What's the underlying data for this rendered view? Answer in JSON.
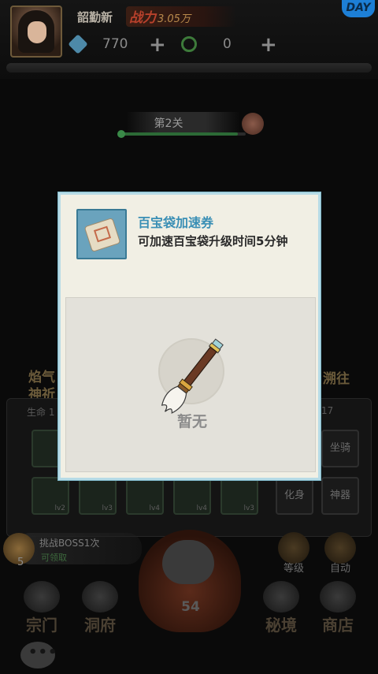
{
  "header": {
    "player_name": "韶勤新",
    "power_label": "战力",
    "power_value": "3.05万",
    "gems": "770",
    "leaves": "0",
    "gem_plus": "+",
    "leaf_plus": "+",
    "ad_badge": "DAY"
  },
  "stage": {
    "label": "第2关",
    "progress": 0.94
  },
  "modal": {
    "item_name": "百宝袋加速券",
    "item_desc": "可加速百宝袋升级时间5分钟",
    "empty_text": "暂无"
  },
  "background": {
    "left_emblem": "焰气神祈",
    "right_emblem": "溯往",
    "stat_life_label": "生命",
    "stat_life_value": "1",
    "stat_right_value": "17",
    "equipment": [
      {
        "level": "lv2"
      },
      {
        "level": "lv3"
      },
      {
        "level": "lv4"
      },
      {
        "level": "lv4"
      },
      {
        "level": "lv3"
      }
    ],
    "side_buttons": [
      "坐骑",
      "化身",
      "神器"
    ],
    "quest_title": "挑战BOSS1次",
    "quest_status": "可领取",
    "quest_count": "5",
    "level_button": "等级",
    "auto_button": "自动",
    "cat_count": "54",
    "nav": [
      "宗门",
      "洞府",
      "秘境",
      "商店"
    ],
    "chat_icon": "chat-bubble-icon"
  },
  "colors": {
    "modal_bg": "#f1efe4",
    "modal_border": "#b7dbe6",
    "item_name": "#3a8fb5",
    "empty_text": "#8c8c8c",
    "progress": "#2c6a36"
  }
}
